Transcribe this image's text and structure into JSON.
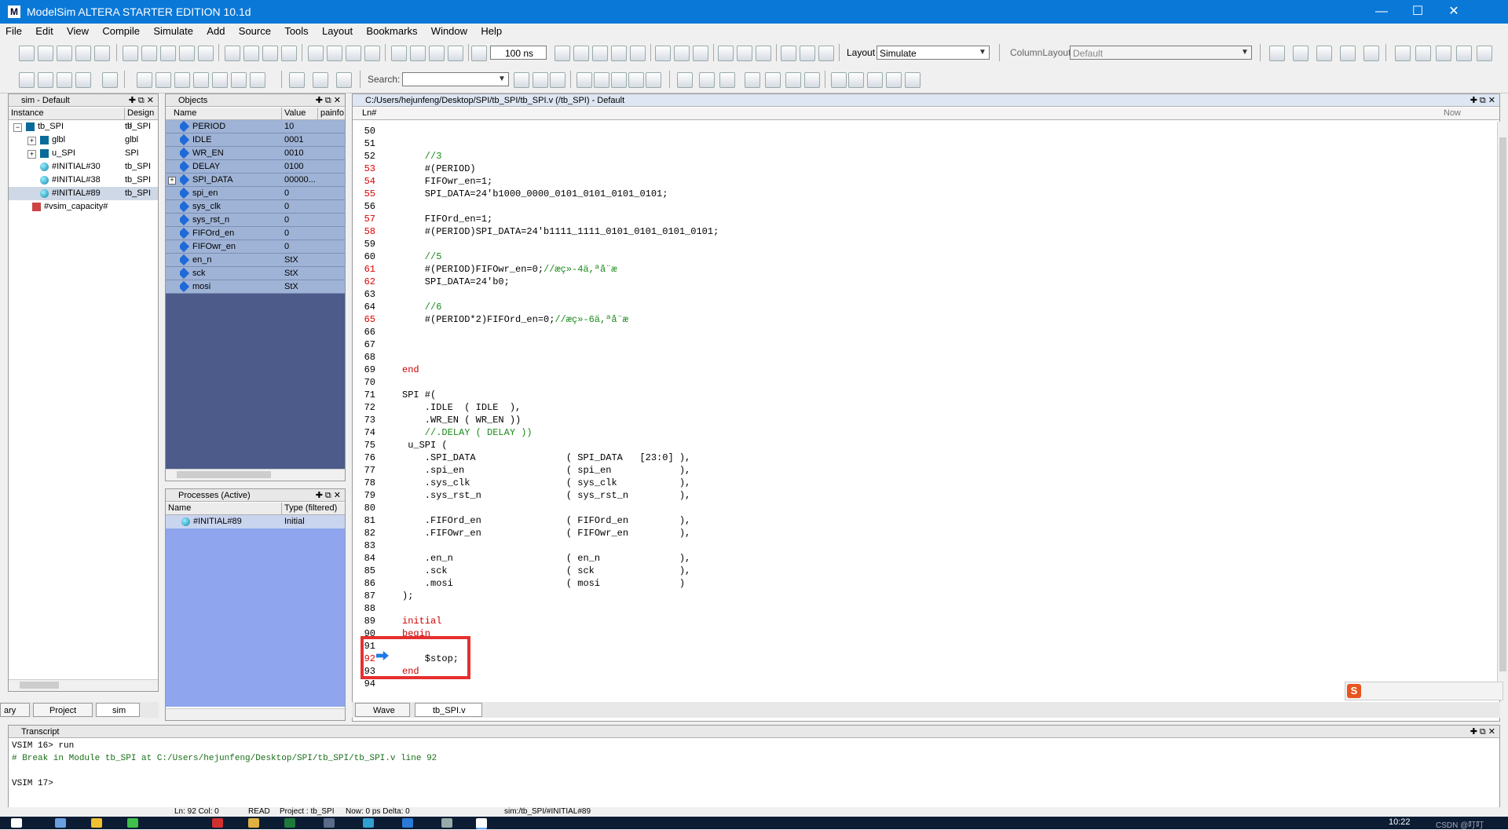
{
  "window": {
    "title": "ModelSim ALTERA STARTER EDITION 10.1d",
    "minimize": "—",
    "maximize": "☐",
    "close": "✕"
  },
  "menu": [
    "File",
    "Edit",
    "View",
    "Compile",
    "Simulate",
    "Add",
    "Source",
    "Tools",
    "Layout",
    "Bookmarks",
    "Window",
    "Help"
  ],
  "toolbar": {
    "run_length": "100 ns",
    "layout_label": "Layout",
    "layout_value": "Simulate",
    "column_layout_label": "ColumnLayout",
    "column_layout_value": "Default",
    "search_label": "Search:"
  },
  "sim_panel": {
    "title": "sim - Default",
    "headers": [
      "Instance",
      "Design u"
    ],
    "rows": [
      {
        "name": "tb_SPI",
        "design": "tb_SPI",
        "expander": "−",
        "icon": "design"
      },
      {
        "name": "glbl",
        "design": "glbl",
        "expander": "+",
        "icon": "design"
      },
      {
        "name": "u_SPI",
        "design": "SPI",
        "expander": "+",
        "icon": "design"
      },
      {
        "name": "#INITIAL#30",
        "design": "tb_SPI",
        "expander": "",
        "icon": "process"
      },
      {
        "name": "#INITIAL#38",
        "design": "tb_SPI",
        "expander": "",
        "icon": "process"
      },
      {
        "name": "#INITIAL#89",
        "design": "tb_SPI",
        "expander": "",
        "icon": "process"
      },
      {
        "name": "#vsim_capacity#",
        "design": "",
        "expander": "",
        "icon": "capacity"
      }
    ],
    "tabs": [
      "ary",
      "Project",
      "sim"
    ]
  },
  "objects_panel": {
    "title": "Objects",
    "headers": [
      "Name",
      "Value",
      "painfo"
    ],
    "rows": [
      {
        "name": "PERIOD",
        "value": "10"
      },
      {
        "name": "IDLE",
        "value": "0001"
      },
      {
        "name": "WR_EN",
        "value": "0010"
      },
      {
        "name": "DELAY",
        "value": "0100"
      },
      {
        "name": "SPI_DATA",
        "value": "00000..."
      },
      {
        "name": "spi_en",
        "value": "0"
      },
      {
        "name": "sys_clk",
        "value": "0"
      },
      {
        "name": "sys_rst_n",
        "value": "0"
      },
      {
        "name": "FIFOrd_en",
        "value": "0"
      },
      {
        "name": "FIFOwr_en",
        "value": "0"
      },
      {
        "name": "en_n",
        "value": "StX"
      },
      {
        "name": "sck",
        "value": "StX"
      },
      {
        "name": "mosi",
        "value": "StX"
      }
    ]
  },
  "processes_panel": {
    "title": "Processes (Active)",
    "headers": [
      "Name",
      "Type (filtered)"
    ],
    "rows": [
      {
        "name": "#INITIAL#89",
        "type": "Initial"
      }
    ]
  },
  "source": {
    "path": "C:/Users/hejunfeng/Desktop/SPI/tb_SPI/tb_SPI.v (/tb_SPI) - Default",
    "ln_header": "Ln#",
    "now_label": "Now",
    "tabs": [
      "Wave",
      "tb_SPI.v"
    ],
    "lines": [
      {
        "n": "50",
        "t": "",
        "red": false,
        "cls": ""
      },
      {
        "n": "51",
        "t": "",
        "red": false,
        "cls": ""
      },
      {
        "n": "52",
        "t": "    //3",
        "red": false,
        "cls": "cm"
      },
      {
        "n": "53",
        "t": "    #(PERIOD)",
        "red": true,
        "cls": ""
      },
      {
        "n": "54",
        "t": "    FIFOwr_en=1;",
        "red": true,
        "cls": ""
      },
      {
        "n": "55",
        "t": "    SPI_DATA=24'b1000_0000_0101_0101_0101_0101;",
        "red": true,
        "cls": ""
      },
      {
        "n": "56",
        "t": "",
        "red": false,
        "cls": ""
      },
      {
        "n": "57",
        "t": "    FIFOrd_en=1;",
        "red": true,
        "cls": ""
      },
      {
        "n": "58",
        "t": "    #(PERIOD)SPI_DATA=24'b1111_1111_0101_0101_0101_0101;",
        "red": true,
        "cls": ""
      },
      {
        "n": "59",
        "t": "",
        "red": false,
        "cls": ""
      },
      {
        "n": "60",
        "t": "    //5",
        "red": false,
        "cls": "cm"
      },
      {
        "n": "61",
        "t": "    #(PERIOD)FIFOwr_en=0;",
        "red": true,
        "cls": "",
        "cm": "//æç»-4ä,ªå¨æ"
      },
      {
        "n": "62",
        "t": "    SPI_DATA=24'b0;",
        "red": true,
        "cls": ""
      },
      {
        "n": "63",
        "t": "",
        "red": false,
        "cls": ""
      },
      {
        "n": "64",
        "t": "    //6",
        "red": false,
        "cls": "cm"
      },
      {
        "n": "65",
        "t": "    #(PERIOD*2)FIFOrd_en=0;",
        "red": true,
        "cls": "",
        "cm": "//æç»-6ä,ªå¨æ"
      },
      {
        "n": "66",
        "t": "",
        "red": false,
        "cls": ""
      },
      {
        "n": "67",
        "t": "",
        "red": false,
        "cls": ""
      },
      {
        "n": "68",
        "t": "",
        "red": false,
        "cls": ""
      },
      {
        "n": "69",
        "t": "end",
        "red": false,
        "cls": "kw"
      },
      {
        "n": "70",
        "t": "",
        "red": false,
        "cls": ""
      },
      {
        "n": "71",
        "t": "SPI #(",
        "red": false,
        "cls": ""
      },
      {
        "n": "72",
        "t": "    .IDLE  ( IDLE  ),",
        "red": false,
        "cls": ""
      },
      {
        "n": "73",
        "t": "    .WR_EN ( WR_EN ))",
        "red": false,
        "cls": ""
      },
      {
        "n": "74",
        "t": "    //.DELAY ( DELAY ))",
        "red": false,
        "cls": "cm"
      },
      {
        "n": "75",
        "t": " u_SPI (",
        "red": false,
        "cls": ""
      },
      {
        "n": "76",
        "t": "    .SPI_DATA                ( SPI_DATA   [23:0] ),",
        "red": false,
        "cls": ""
      },
      {
        "n": "77",
        "t": "    .spi_en                  ( spi_en            ),",
        "red": false,
        "cls": ""
      },
      {
        "n": "78",
        "t": "    .sys_clk                 ( sys_clk           ),",
        "red": false,
        "cls": ""
      },
      {
        "n": "79",
        "t": "    .sys_rst_n               ( sys_rst_n         ),",
        "red": false,
        "cls": ""
      },
      {
        "n": "80",
        "t": "",
        "red": false,
        "cls": ""
      },
      {
        "n": "81",
        "t": "    .FIFOrd_en               ( FIFOrd_en         ),",
        "red": false,
        "cls": ""
      },
      {
        "n": "82",
        "t": "    .FIFOwr_en               ( FIFOwr_en         ),",
        "red": false,
        "cls": ""
      },
      {
        "n": "83",
        "t": "",
        "red": false,
        "cls": ""
      },
      {
        "n": "84",
        "t": "    .en_n                    ( en_n              ),",
        "red": false,
        "cls": ""
      },
      {
        "n": "85",
        "t": "    .sck                     ( sck               ),",
        "red": false,
        "cls": ""
      },
      {
        "n": "86",
        "t": "    .mosi                    ( mosi              )",
        "red": false,
        "cls": ""
      },
      {
        "n": "87",
        "t": ");",
        "red": false,
        "cls": ""
      },
      {
        "n": "88",
        "t": "",
        "red": false,
        "cls": ""
      },
      {
        "n": "89",
        "t": "initial",
        "red": false,
        "cls": "kw"
      },
      {
        "n": "90",
        "t": "begin",
        "red": false,
        "cls": "kw"
      },
      {
        "n": "91",
        "t": "",
        "red": false,
        "cls": ""
      },
      {
        "n": "92",
        "t": "    $stop;",
        "red": true,
        "cls": ""
      },
      {
        "n": "93",
        "t": "end",
        "red": false,
        "cls": "kw"
      },
      {
        "n": "94",
        "t": "",
        "red": false,
        "cls": ""
      }
    ]
  },
  "transcript": {
    "title": "Transcript",
    "lines": [
      {
        "t": "VSIM 16> run",
        "color": "#000"
      },
      {
        "t": "# Break in Module tb_SPI at C:/Users/hejunfeng/Desktop/SPI/tb_SPI/tb_SPI.v line 92",
        "color": "#1a6e1a"
      },
      {
        "t": "",
        "color": "#000"
      },
      {
        "t": "VSIM 17>",
        "color": "#000"
      }
    ]
  },
  "status": {
    "position": "Ln:  92  Col: 0",
    "mode": "READ",
    "project": "Project : tb_SPI",
    "now": "Now: 0 ps  Delta: 0",
    "context": "sim:/tb_SPI/#INITIAL#89"
  },
  "taskbar": {
    "clock": "10:22",
    "watermark": "CSDN @叮叮"
  },
  "colors": {
    "accent": "#0a78d7",
    "objects_bg": "#4d5b8a",
    "processes_bg": "#8fa6ee",
    "highlight": "#e53030"
  }
}
